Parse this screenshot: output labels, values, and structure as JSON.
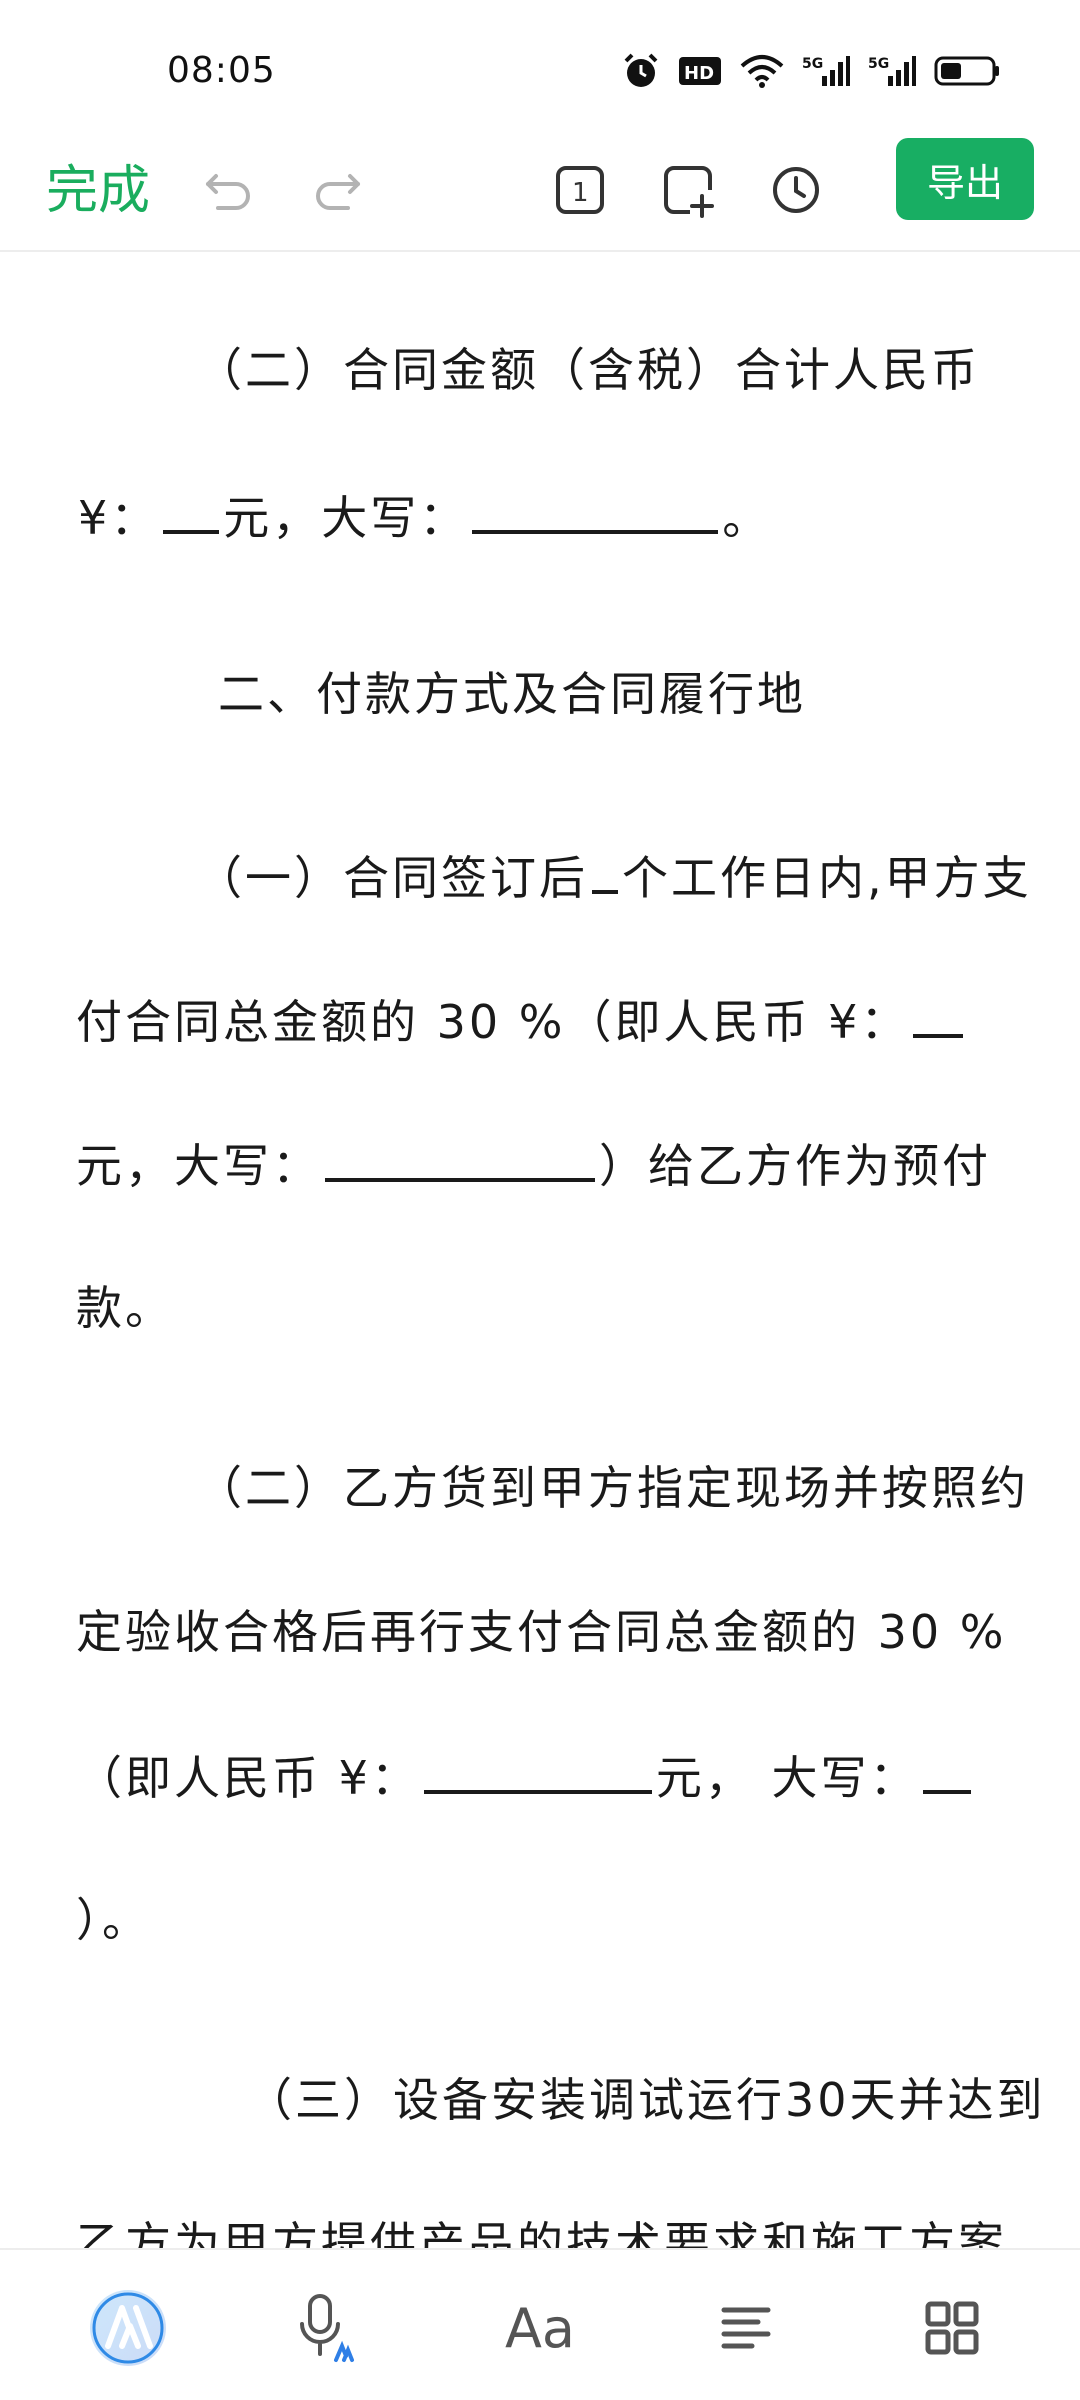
{
  "status_bar": {
    "time": "08:05",
    "icons": [
      "alarm-icon",
      "hd-icon",
      "wifi-icon",
      "5g-signal-icon",
      "5g-signal-icon",
      "battery-icon"
    ],
    "hd_label": "HD",
    "network_label": "5G"
  },
  "toolbar": {
    "done_label": "完成",
    "page_count": "1",
    "export_label": "导出",
    "accent_color": "#18ae63"
  },
  "document": {
    "lines": [
      "（二）合同金额（含税）合计人民币",
      "¥：",
      "元，大写：",
      "。",
      "二、付款方式及合同履行地",
      "（一）合同签订后",
      "个工作日内,甲方支",
      "付合同总金额的 30 %（即人民币 ¥：",
      "元，大写：",
      "）给乙方作为预付",
      "款。",
      "（二）乙方货到甲方指定现场并按照约",
      "定验收合格后再行支付合同总金额的 30 %",
      "（即人民币 ¥：",
      "元， 大写：",
      "）。",
      "（三）设备安装调试运行30天并达到",
      "乙方为甲方提供产品的技术要求和施工方案"
    ]
  },
  "bottom_bar": {
    "items": [
      "ai-assistant-icon",
      "voice-input-icon",
      "font-format-icon",
      "paragraph-align-icon",
      "more-grid-icon"
    ],
    "font_label": "Aa"
  }
}
